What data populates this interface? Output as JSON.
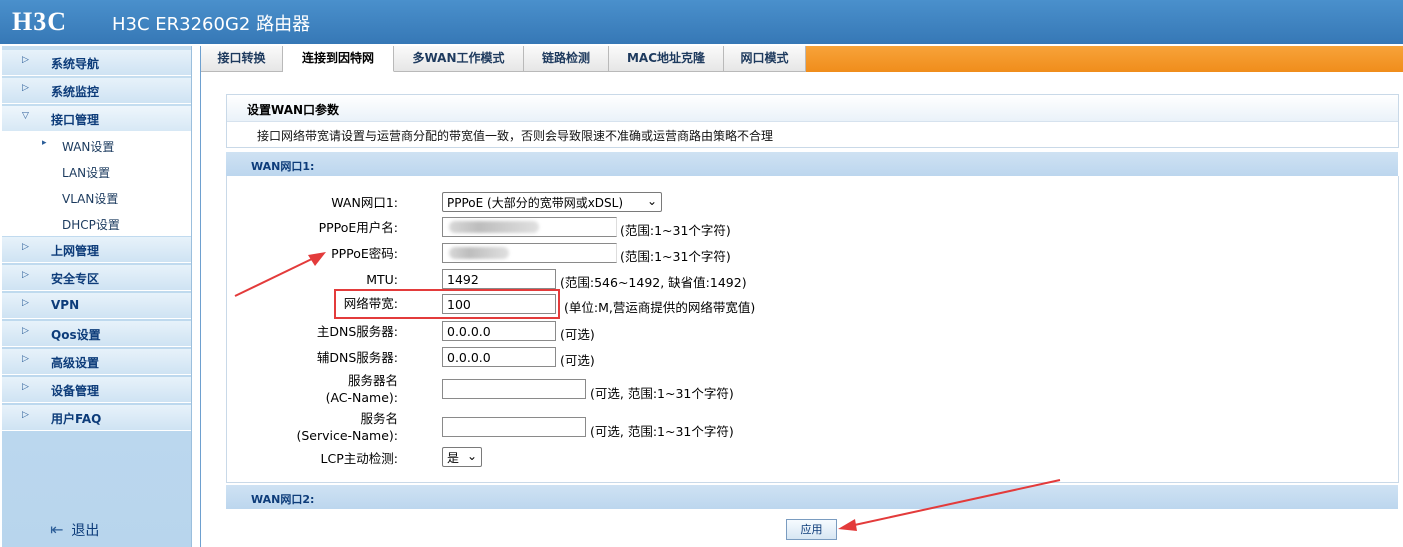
{
  "header": {
    "logo": "H3C",
    "router_name": "H3C ER3260G2 路由器"
  },
  "sidebar": {
    "items": [
      {
        "label": "系统导航"
      },
      {
        "label": "系统监控"
      },
      {
        "label": "接口管理"
      },
      {
        "label": "上网管理"
      },
      {
        "label": "安全专区"
      },
      {
        "label": "VPN"
      },
      {
        "label": "Qos设置"
      },
      {
        "label": "高级设置"
      },
      {
        "label": "设备管理"
      },
      {
        "label": "用户FAQ"
      }
    ],
    "submenu": [
      {
        "label": "WAN设置"
      },
      {
        "label": "LAN设置"
      },
      {
        "label": "VLAN设置"
      },
      {
        "label": "DHCP设置"
      }
    ],
    "logout_label": "退出"
  },
  "tabs": [
    {
      "label": "接口转换"
    },
    {
      "label": "连接到因特网"
    },
    {
      "label": "多WAN工作模式"
    },
    {
      "label": "链路检测"
    },
    {
      "label": "MAC地址克隆"
    },
    {
      "label": "网口模式"
    }
  ],
  "panel": {
    "title": "设置WAN口参数",
    "description": "接口网络带宽请设置与运营商分配的带宽值一致，否则会导致限速不准确或运营商路由策略不合理"
  },
  "wan1": {
    "section_title": "WAN网口1:",
    "wan_port_label": "WAN网口1:",
    "wan_port_value": "PPPoE (大部分的宽带网或xDSL)",
    "username_label": "PPPoE用户名:",
    "username_hint": "(范围:1~31个字符)",
    "password_label": "PPPoE密码:",
    "password_hint": "(范围:1~31个字符)",
    "mtu_label": "MTU:",
    "mtu_value": "1492",
    "mtu_hint": "(范围:546~1492, 缺省值:1492)",
    "bandwidth_label": "网络带宽:",
    "bandwidth_value": "100",
    "bandwidth_hint": "(单位:M,营运商提供的网络带宽值)",
    "primary_dns_label": "主DNS服务器:",
    "primary_dns_value": "0.0.0.0",
    "primary_dns_hint": "(可选)",
    "secondary_dns_label": "辅DNS服务器:",
    "secondary_dns_value": "0.0.0.0",
    "secondary_dns_hint": "(可选)",
    "ac_name_label_1": "服务器名",
    "ac_name_label_2": "(AC-Name):",
    "ac_name_hint": "(可选, 范围:1~31个字符)",
    "service_name_label_1": "服务名",
    "service_name_label_2": "(Service-Name):",
    "service_name_hint": "(可选, 范围:1~31个字符)",
    "lcp_label": "LCP主动检测:",
    "lcp_value": "是"
  },
  "wan2": {
    "section_title": "WAN网口2:"
  },
  "apply_label": "应用",
  "colors": {
    "header": "#3c84c2",
    "tab_bar": "#f08d1b",
    "highlight": "#e33b3b"
  }
}
